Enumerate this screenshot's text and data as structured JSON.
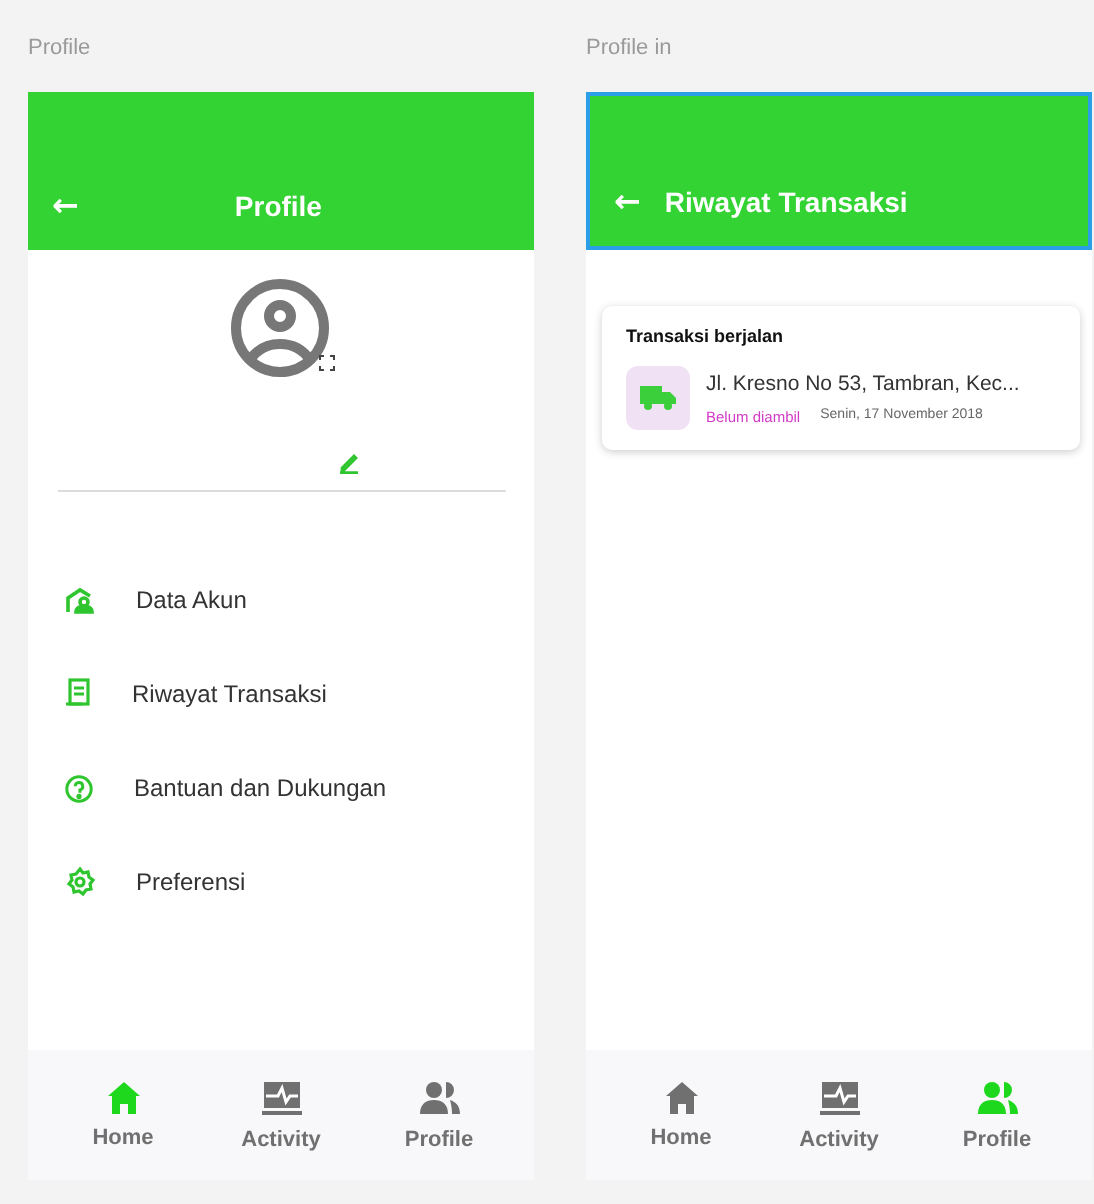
{
  "frames": [
    {
      "label": "Profile",
      "selected": false,
      "kind": "profile",
      "header": {
        "back": "←",
        "title": "Profile"
      },
      "menu": [
        {
          "label": "Data Akun"
        },
        {
          "label": "Riwayat Transaksi"
        },
        {
          "label": "Bantuan dan Dukungan"
        },
        {
          "label": "Preferensi"
        }
      ],
      "nav": [
        {
          "label": "Home",
          "selected": true
        },
        {
          "label": "Activity",
          "selected": false
        },
        {
          "label": "Profile",
          "selected": false
        }
      ]
    },
    {
      "label": "Profile in",
      "selected": true,
      "kind": "history",
      "header": {
        "back": "←",
        "title": "Riwayat Transaksi"
      },
      "card": {
        "title": "Transaksi berjalan",
        "address": "Jl. Kresno No 53,  Tambran, Kec...",
        "status": "Belum diambil",
        "date": "Senin, 17 November 2018"
      },
      "nav": [
        {
          "label": "Home",
          "selected": false
        },
        {
          "label": "Activity",
          "selected": false
        },
        {
          "label": "Profile",
          "selected": true
        }
      ]
    }
  ]
}
